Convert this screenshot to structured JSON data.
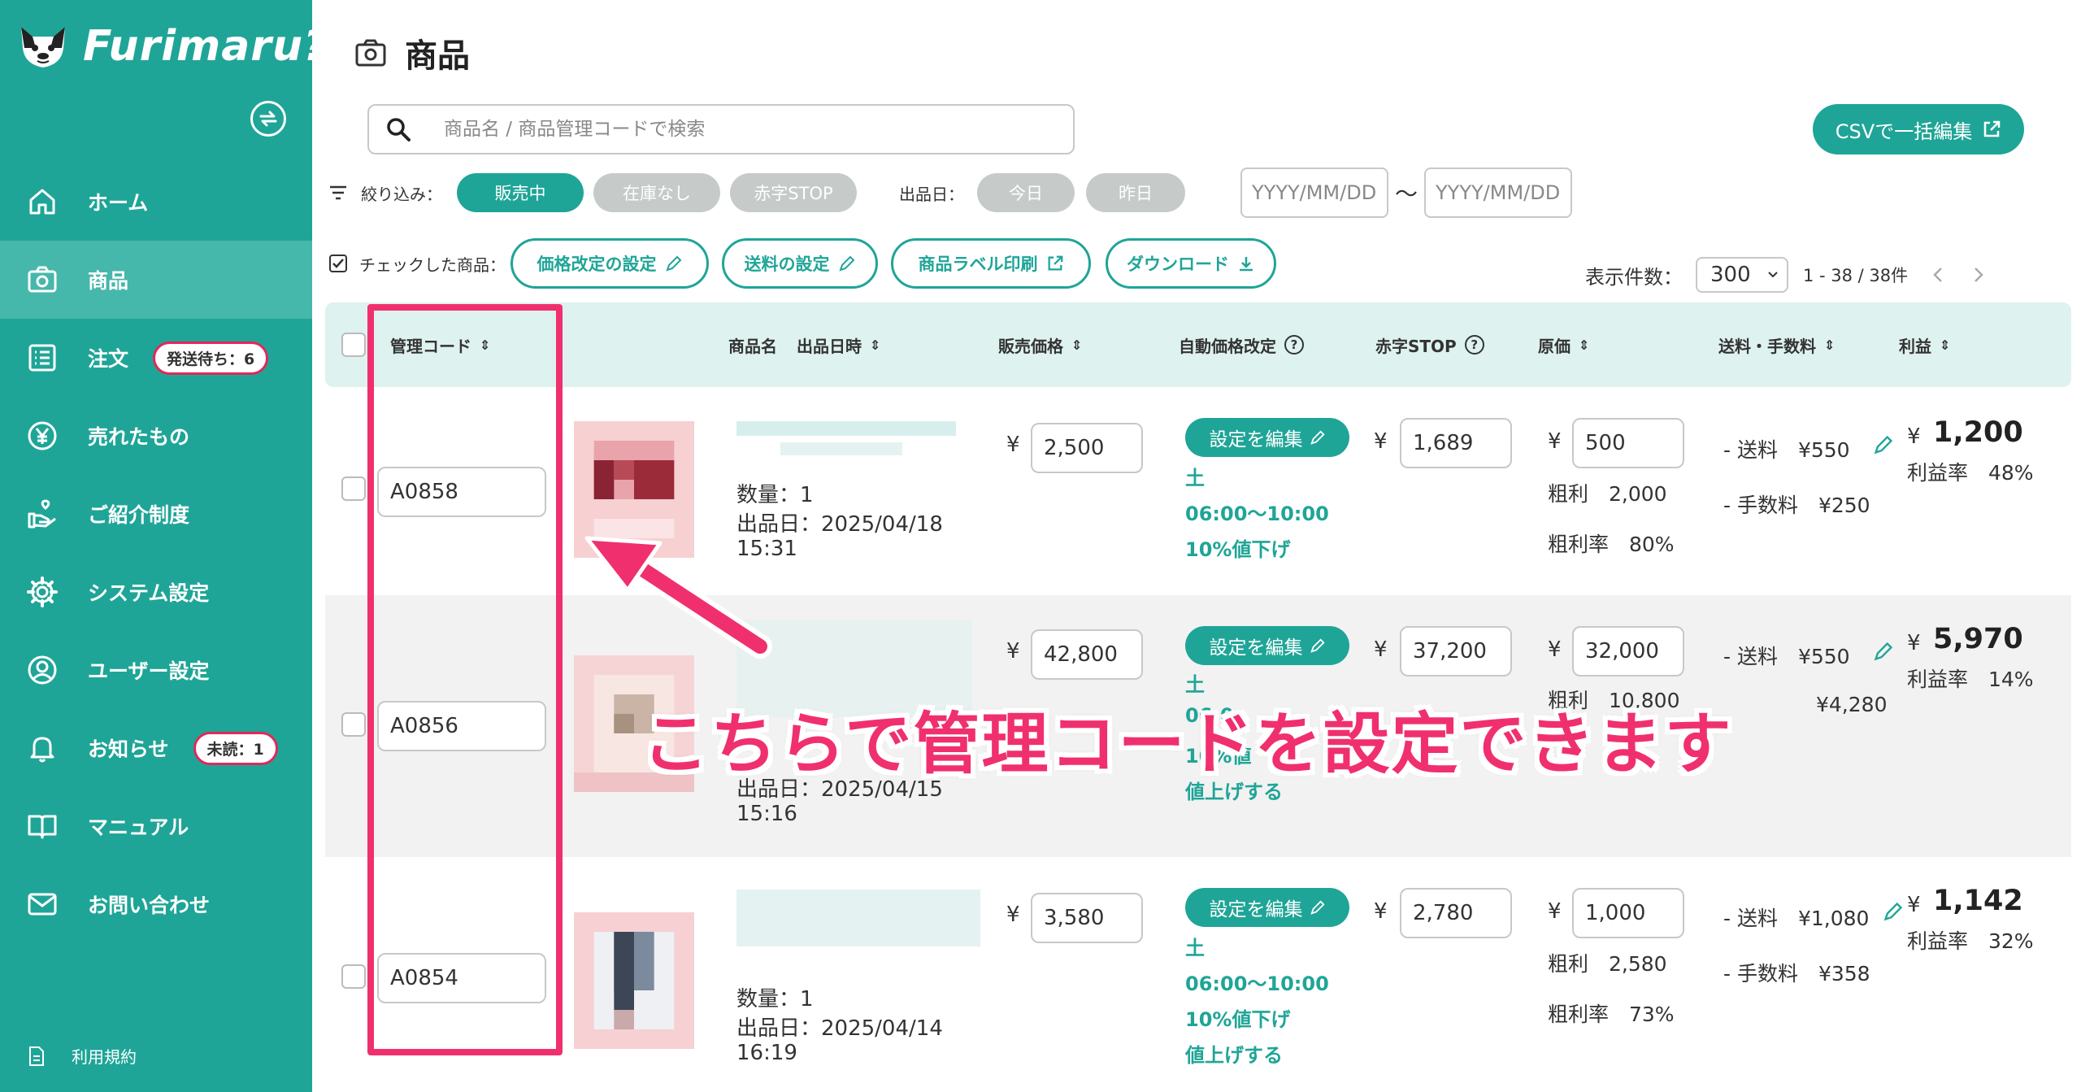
{
  "app": {
    "logo_text": "Furimaru?"
  },
  "sidebar": {
    "items": [
      {
        "label": "ホーム",
        "icon": "home-icon"
      },
      {
        "label": "商品",
        "icon": "camera-icon",
        "active": true
      },
      {
        "label": "注文",
        "icon": "list-icon",
        "badge": "発送待ち：6"
      },
      {
        "label": "売れたもの",
        "icon": "yen-icon"
      },
      {
        "label": "ご紹介制度",
        "icon": "hand-heart-icon"
      },
      {
        "label": "システム設定",
        "icon": "gear-icon"
      },
      {
        "label": "ユーザー設定",
        "icon": "user-icon"
      },
      {
        "label": "お知らせ",
        "icon": "bell-icon",
        "badge": "未読：1"
      },
      {
        "label": "マニュアル",
        "icon": "book-icon"
      },
      {
        "label": "お問い合わせ",
        "icon": "mail-icon"
      }
    ],
    "terms": "利用規約"
  },
  "page": {
    "title": "商品"
  },
  "search": {
    "placeholder": "商品名 / 商品管理コードで検索"
  },
  "csv_button": "CSVで一括編集",
  "filters": {
    "label": "絞り込み：",
    "status": [
      "販売中",
      "在庫なし",
      "赤字STOP"
    ],
    "date_label": "出品日：",
    "dates": [
      "今日",
      "昨日"
    ],
    "date_from_placeholder": "YYYY/MM/DD",
    "date_to_placeholder": "YYYY/MM/DD",
    "range_sep": "〜"
  },
  "bulk": {
    "label": "チェックした商品：",
    "buttons": [
      "価格改定の設定",
      "送料の設定",
      "商品ラベル印刷",
      "ダウンロード"
    ]
  },
  "pagination": {
    "per_page_label": "表示件数：",
    "per_page": "300",
    "range": "1 - 38 / 38件"
  },
  "table": {
    "headers": {
      "code": "管理コード",
      "name": "商品名",
      "listed": "出品日時",
      "price": "販売価格",
      "auto": "自動価格改定",
      "stop": "赤字STOP",
      "cost": "原価",
      "fees": "送料・手数料",
      "profit": "利益"
    },
    "rows": [
      {
        "code": "A0858",
        "qty": "数量：1",
        "date": "出品日：2025/04/18",
        "time": "15:31",
        "price": "2,500",
        "edit": "設定を編集",
        "day": "土",
        "hours": "06:00〜10:00",
        "rule": "10%値下げ",
        "rule2": "",
        "stop": "1,689",
        "cost": "500",
        "gross": "粗利　2,000",
        "gross_rate": "粗利率　80%",
        "shipping": "- 送料　¥550",
        "fee": "- 手数料　¥250",
        "profit": "1,200",
        "profit_rate": "利益率　48%"
      },
      {
        "code": "A0856",
        "qty": "",
        "date": "出品日：2025/04/15",
        "time": "15:16",
        "price": "42,800",
        "edit": "設定を編集",
        "day": "土",
        "hours": "06:0",
        "rule": "10%値",
        "rule2": "値上げする",
        "stop": "37,200",
        "cost": "32,000",
        "gross": "粗利　10,800",
        "gross_rate": "",
        "shipping": "- 送料　¥550",
        "fee": "¥4,280",
        "profit": "5,970",
        "profit_rate": "利益率　14%"
      },
      {
        "code": "A0854",
        "qty": "数量：1",
        "date": "出品日：2025/04/14",
        "time": "16:19",
        "price": "3,580",
        "edit": "設定を編集",
        "day": "土",
        "hours": "06:00〜10:00",
        "rule": "10%値下げ",
        "rule2": "値上げする",
        "stop": "2,780",
        "cost": "1,000",
        "gross": "粗利　2,580",
        "gross_rate": "粗利率　73%",
        "shipping": "- 送料　¥1,080",
        "fee": "- 手数料　¥358",
        "profit": "1,142",
        "profit_rate": "利益率　32%"
      }
    ]
  },
  "currency": "¥",
  "annotation": "こちらで管理コードを設定できます",
  "colors": {
    "primary": "#1fa597",
    "accent": "#f0306e",
    "header_bg": "#def2ef"
  }
}
